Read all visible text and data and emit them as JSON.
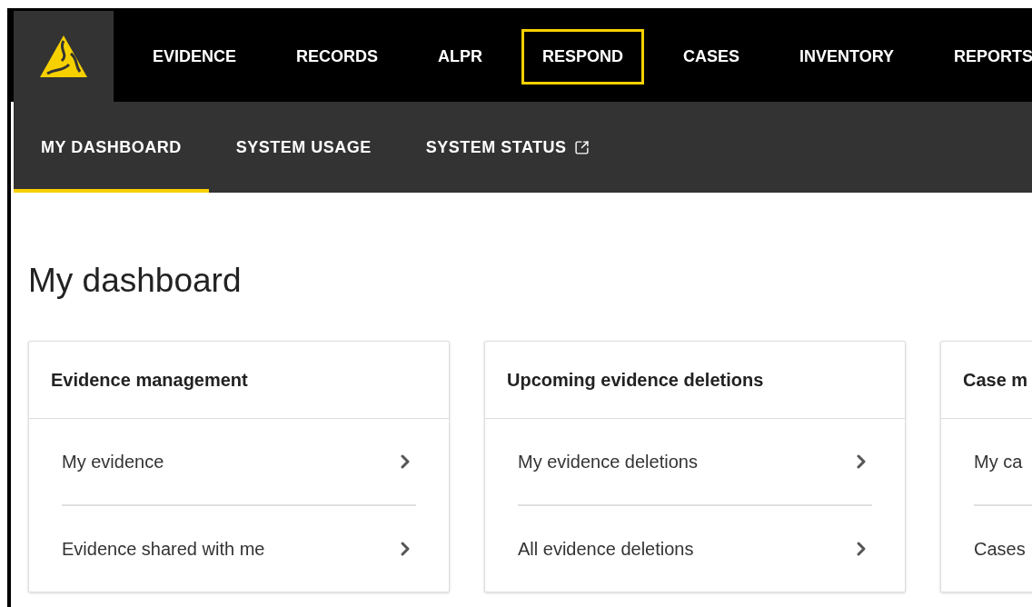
{
  "nav": {
    "items": [
      {
        "label": "EVIDENCE",
        "focused": false
      },
      {
        "label": "RECORDS",
        "focused": false
      },
      {
        "label": "ALPR",
        "focused": false
      },
      {
        "label": "RESPOND",
        "focused": true
      },
      {
        "label": "CASES",
        "focused": false
      },
      {
        "label": "INVENTORY",
        "focused": false
      },
      {
        "label": "REPORTS",
        "focused": false
      }
    ]
  },
  "subnav": {
    "items": [
      {
        "label": "MY DASHBOARD",
        "selected": true,
        "external": false
      },
      {
        "label": "SYSTEM USAGE",
        "selected": false,
        "external": false
      },
      {
        "label": "SYSTEM STATUS",
        "selected": false,
        "external": true
      }
    ]
  },
  "page_title": "My dashboard",
  "cards": [
    {
      "title": "Evidence management",
      "rows": [
        "My evidence",
        "Evidence shared with me"
      ]
    },
    {
      "title": "Upcoming evidence deletions",
      "rows": [
        "My evidence deletions",
        "All evidence deletions"
      ]
    },
    {
      "title": "Case m",
      "rows": [
        "My ca",
        "Cases"
      ]
    }
  ]
}
